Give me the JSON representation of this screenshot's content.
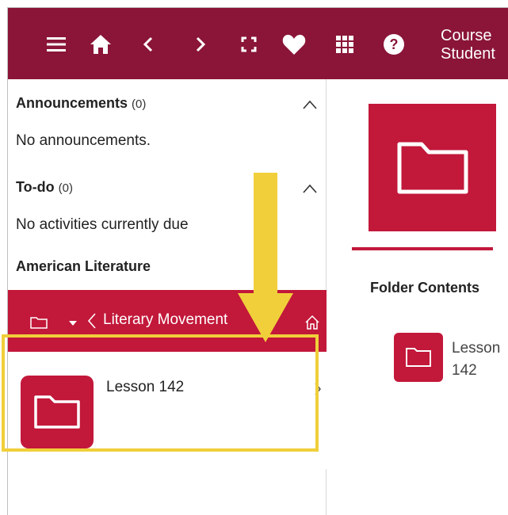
{
  "topbar": {
    "icons": [
      "menu-icon",
      "home-icon",
      "back-chevron-icon",
      "forward-chevron-icon",
      "fullscreen-icon",
      "heart-icon",
      "apps-grid-icon",
      "help-icon"
    ],
    "title_line1": "Course",
    "title_line2": "Student",
    "color": "#8a1538"
  },
  "sidebar": {
    "announcements": {
      "label": "Announcements",
      "count": "(0)",
      "empty_text": "No announcements."
    },
    "todo": {
      "label": "To-do",
      "count": "(0)",
      "empty_text": "No activities currently due"
    },
    "course_title": "American Literature",
    "breadcrumb": {
      "label": "Literary Movement",
      "color": "#c2183a"
    },
    "items": [
      {
        "label": "Lesson 142"
      }
    ],
    "highlight_color": "#f0cf3a"
  },
  "main": {
    "folder_contents_title": "Folder Contents",
    "items": [
      {
        "label": "Lesson 142"
      }
    ]
  }
}
